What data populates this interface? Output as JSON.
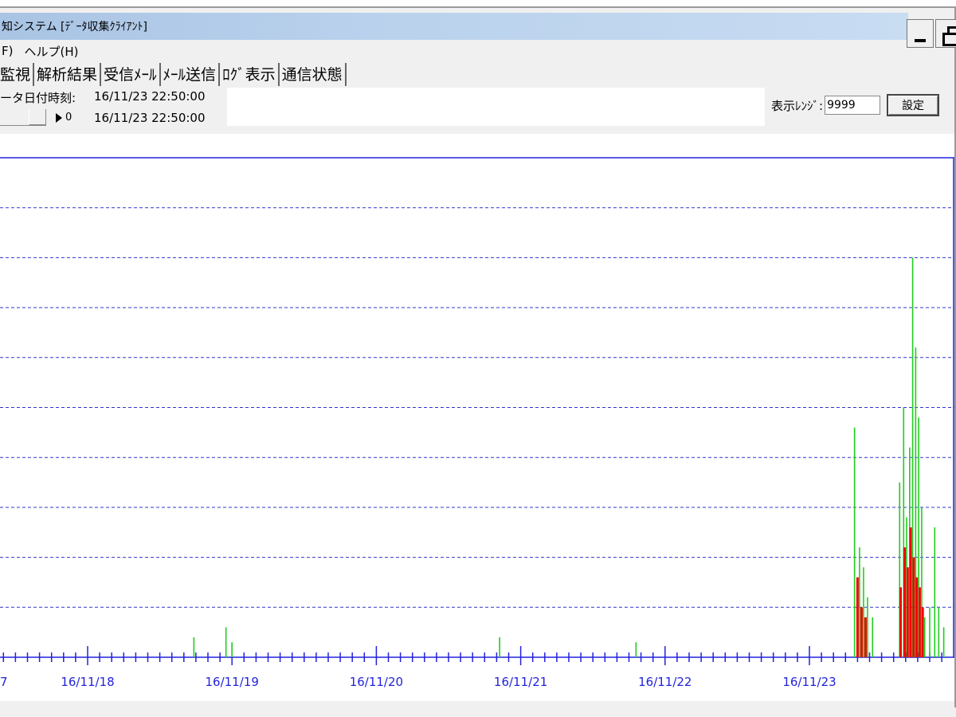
{
  "window": {
    "title": "知システム [ﾃﾞｰﾀ収集ｸﾗｲｱﾝﾄ]"
  },
  "menu": [
    "F)",
    "ヘルプ(H)"
  ],
  "tabs": [
    {
      "label": "監視",
      "active": true
    },
    {
      "label": "解析結果",
      "active": false
    },
    {
      "label": "受信ﾒｰﾙ",
      "active": false
    },
    {
      "label": "ﾒｰﾙ送信",
      "active": false
    },
    {
      "label": "ﾛｸﾞ表示",
      "active": false
    },
    {
      "label": "通信状態",
      "active": false
    }
  ],
  "info": {
    "datetime_label": "ータ日付時刻:",
    "datetime_value": "16/11/23 22:50:00",
    "slider_value": "0",
    "slider_datetime": "16/11/23 22:50:00"
  },
  "range": {
    "label": "表示ﾚﾝｼﾞ:",
    "value": "9999",
    "button_label": "設定"
  },
  "colors": {
    "axis": "#2222dd",
    "grid": "#3333cc",
    "series_green": "#22cc22",
    "series_red": "#ee0000"
  },
  "chart_data": {
    "type": "bar",
    "x_tick_labels": [
      "7",
      "16/11/18",
      "16/11/19",
      "16/11/20",
      "16/11/21",
      "16/11/22",
      "16/11/23"
    ],
    "x_range": [
      "16/11/17",
      "16/11/23 22:50:00"
    ],
    "grid": "horizontal dashed",
    "y_gridlines": 10,
    "series": [
      {
        "color": "green",
        "x": [
          "16/11/18 17:40",
          "16/11/18 23:00",
          "16/11/19 00:00",
          "16/11/20 20:30",
          "16/11/21 19:10",
          "16/11/23 07:30",
          "16/11/23 08:20",
          "16/11/23 09:00",
          "16/11/23 09:40",
          "16/11/23 10:30",
          "16/11/23 15:00",
          "16/11/23 15:40",
          "16/11/23 16:10",
          "16/11/23 16:40",
          "16/11/23 17:10",
          "16/11/23 17:40",
          "16/11/23 18:10",
          "16/11/23 18:40",
          "16/11/23 19:10",
          "16/11/23 20:00",
          "16/11/23 20:50",
          "16/11/23 21:30",
          "16/11/23 22:20"
        ],
        "values": [
          4,
          6,
          3,
          4,
          3,
          46,
          22,
          18,
          12,
          8,
          35,
          50,
          28,
          42,
          80,
          62,
          48,
          30,
          8,
          10,
          26,
          10,
          6
        ]
      },
      {
        "color": "red",
        "x": [
          "16/11/23 08:00",
          "16/11/23 08:40",
          "16/11/23 09:20",
          "16/11/23 15:10",
          "16/11/23 15:50",
          "16/11/23 16:20",
          "16/11/23 16:50",
          "16/11/23 17:20",
          "16/11/23 17:50",
          "16/11/23 18:20",
          "16/11/23 18:50"
        ],
        "values": [
          16,
          10,
          8,
          14,
          22,
          18,
          26,
          20,
          16,
          14,
          10
        ]
      }
    ],
    "y_max": 100
  }
}
